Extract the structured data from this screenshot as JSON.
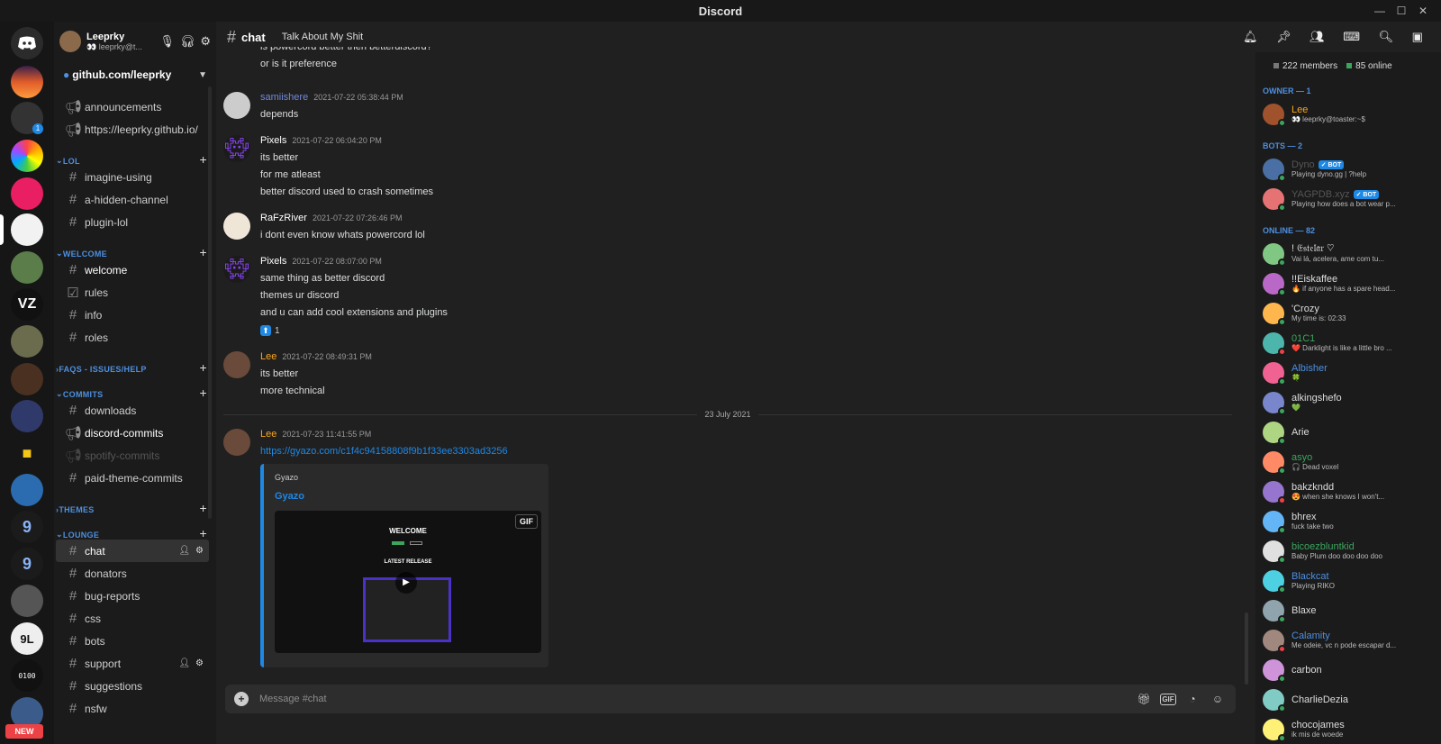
{
  "window": {
    "title": "Discord"
  },
  "user": {
    "name": "Leeprky",
    "tag": "👀 leeprky@t..."
  },
  "server": {
    "name": "github.com/leeprky"
  },
  "channels": {
    "top": [
      {
        "label": "announcements",
        "icon": "megaphone"
      },
      {
        "label": "https://leeprky.github.io/",
        "icon": "megaphone"
      }
    ],
    "categories": [
      {
        "name": "LOL",
        "items": [
          "imagine-using",
          "a-hidden-channel",
          "plugin-lol"
        ]
      },
      {
        "name": "WELCOME",
        "items": [
          "welcome",
          "rules",
          "info",
          "roles"
        ]
      },
      {
        "name": "FAQS - ISSUES/HELP",
        "items": []
      },
      {
        "name": "COMMITS",
        "items": [
          "downloads",
          "discord-commits",
          "spotify-commits",
          "paid-theme-commits"
        ]
      },
      {
        "name": "THEMES",
        "items": []
      },
      {
        "name": "LOUNGE",
        "items": [
          "chat",
          "donators",
          "bug-reports",
          "css",
          "bots",
          "support",
          "suggestions",
          "nsfw"
        ]
      }
    ]
  },
  "servers": {
    "badge_count": "1",
    "new_label": "NEW"
  },
  "channel_header": {
    "name": "chat",
    "topic": "Talk About My Shit"
  },
  "messages": {
    "partial_top": [
      "is powercord better then betterdiscord?",
      "or is it preference"
    ],
    "groups": [
      {
        "author": "samiishere",
        "color": "#7289da",
        "time": "2021-07-22 05:38:44 PM",
        "lines": [
          "depends"
        ]
      },
      {
        "author": "Pixels",
        "color": "#ffffff",
        "time": "2021-07-22 06:04:20 PM",
        "lines": [
          "its better",
          "for me atleast",
          "better discord used to crash sometimes"
        ]
      },
      {
        "author": "RaFzRiver",
        "color": "#ffffff",
        "time": "2021-07-22 07:26:46 PM",
        "lines": [
          "i dont even know whats powercord lol"
        ]
      },
      {
        "author": "Pixels",
        "color": "#ffffff",
        "time": "2021-07-22 08:07:00 PM",
        "lines": [
          "same thing as better discord",
          "themes ur discord",
          "and u can add cool extensions and plugins"
        ],
        "reaction": {
          "emoji": "⬆",
          "count": "1"
        }
      },
      {
        "author": "Lee",
        "color": "#faa61a",
        "time": "2021-07-22 08:49:31 PM",
        "lines": [
          "its better",
          "more technical"
        ]
      }
    ],
    "date_divider": "23 July 2021",
    "last": {
      "author": "Lee",
      "color": "#faa61a",
      "time": "2021-07-23 11:41:55 PM",
      "link": "https://gyazo.com/c1f4c94158808f9b1f33ee3303ad3256",
      "embed": {
        "provider": "Gyazo",
        "title": "Gyazo",
        "gif_label": "GIF",
        "image_heading": "WELCOME",
        "image_sub": "LATEST RELEASE"
      }
    }
  },
  "input": {
    "placeholder": "Message #chat"
  },
  "members": {
    "total": "222 members",
    "online": "85 online",
    "groups": [
      {
        "label": "OWNER — 1",
        "items": [
          {
            "name": "Lee",
            "color": "#faa61a",
            "status": "👀 leeprky@toaster:~$"
          }
        ]
      },
      {
        "label": "BOTS — 2",
        "items": [
          {
            "name": "Dyno",
            "color": "#555",
            "bot": "✓ BOT",
            "status": "Playing dyno.gg | ?help"
          },
          {
            "name": "YAGPDB.xyz",
            "color": "#555",
            "bot": "✓ BOT",
            "status": "Playing how does a bot wear p..."
          }
        ]
      },
      {
        "label": "ONLINE — 82",
        "items": [
          {
            "name": "! 𝔈𝔰𝔱𝔢𝔩𝔞𝔯 ♡",
            "color": "#ddd",
            "status": "Vai lá, acelera, ame com tu..."
          },
          {
            "name": "!!Eiskaffee",
            "color": "#ddd",
            "status": "🔥 if anyone has a spare head..."
          },
          {
            "name": "'Crozy",
            "color": "#ddd",
            "status": "My time is: 02:33"
          },
          {
            "name": "01C1",
            "color": "#3ba55d",
            "status": "❤️ Darklight is like a little bro ..."
          },
          {
            "name": "Albisher",
            "color": "#4d8fe0",
            "status": "🍀"
          },
          {
            "name": "alkingshefo",
            "color": "#ddd",
            "status": "💚"
          },
          {
            "name": "Arie",
            "color": "#ddd",
            "status": ""
          },
          {
            "name": "asyo",
            "color": "#3ba55d",
            "status": "🎧 Dead voxel"
          },
          {
            "name": "bakzkndd",
            "color": "#ddd",
            "status": "😍 when she knows I won't..."
          },
          {
            "name": "bhrex",
            "color": "#ddd",
            "status": "fuck take two"
          },
          {
            "name": "bicoezbluntkid",
            "color": "#3ba55d",
            "status": "Baby Plum doo doo doo doo"
          },
          {
            "name": "Blackcat",
            "color": "#4d8fe0",
            "status": "Playing RIKO"
          },
          {
            "name": "Blaxe",
            "color": "#ddd",
            "status": ""
          },
          {
            "name": "Calamity",
            "color": "#4d8fe0",
            "status": "Me odeie, vc n pode escapar d..."
          },
          {
            "name": "carbon",
            "color": "#ddd",
            "status": ""
          },
          {
            "name": "CharlieDezia",
            "color": "#ddd",
            "status": ""
          },
          {
            "name": "chocojames",
            "color": "#ddd",
            "status": "ik mis de woede"
          }
        ]
      }
    ]
  },
  "colors": {
    "accent": "#1e88e5",
    "category": "#4d8fe0",
    "online": "#3ba55d"
  }
}
